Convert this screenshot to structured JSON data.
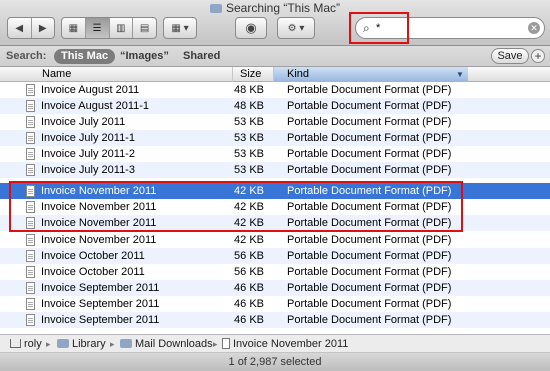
{
  "window": {
    "title": "Searching “This Mac”"
  },
  "toolbar": {
    "back_glyph": "◀",
    "forward_glyph": "▶",
    "view_icon_glyph": "▦",
    "view_list_glyph": "☰",
    "view_column_glyph": "▥",
    "view_coverflow_glyph": "▤",
    "arrange_glyph": "▦ ▾",
    "quicklook_glyph": "◉",
    "action_glyph": "⚙ ▾"
  },
  "search": {
    "value": "*",
    "clear_glyph": "✕"
  },
  "scope": {
    "label": "Search:",
    "this_mac": "This Mac",
    "images": "“Images”",
    "shared": "Shared",
    "save": "Save",
    "plus": "+"
  },
  "columns": {
    "name": "Name",
    "size": "Size",
    "kind": "Kind",
    "sort_arrow": "▼"
  },
  "files": [
    {
      "name": "Invoice August 2011",
      "size": "48 KB",
      "kind": "Portable Document Format (PDF)"
    },
    {
      "name": "Invoice August 2011-1",
      "size": "48 KB",
      "kind": "Portable Document Format (PDF)"
    },
    {
      "name": "Invoice July 2011",
      "size": "53 KB",
      "kind": "Portable Document Format (PDF)"
    },
    {
      "name": "Invoice July 2011-1",
      "size": "53 KB",
      "kind": "Portable Document Format (PDF)"
    },
    {
      "name": "Invoice July 2011-2",
      "size": "53 KB",
      "kind": "Portable Document Format (PDF)"
    },
    {
      "name": "Invoice July 2011-3",
      "size": "53 KB",
      "kind": "Portable Document Format (PDF)"
    },
    {
      "name": "Invoice November 2011",
      "size": "42 KB",
      "kind": "Portable Document Format (PDF)"
    },
    {
      "name": "Invoice November 2011",
      "size": "42 KB",
      "kind": "Portable Document Format (PDF)"
    },
    {
      "name": "Invoice November 2011",
      "size": "42 KB",
      "kind": "Portable Document Format (PDF)"
    },
    {
      "name": "Invoice November 2011",
      "size": "42 KB",
      "kind": "Portable Document Format (PDF)"
    },
    {
      "name": "Invoice October 2011",
      "size": "56 KB",
      "kind": "Portable Document Format (PDF)"
    },
    {
      "name": "Invoice October 2011",
      "size": "56 KB",
      "kind": "Portable Document Format (PDF)"
    },
    {
      "name": "Invoice September 2011",
      "size": "46 KB",
      "kind": "Portable Document Format (PDF)"
    },
    {
      "name": "Invoice September 2011",
      "size": "46 KB",
      "kind": "Portable Document Format (PDF)"
    },
    {
      "name": "Invoice September 2011",
      "size": "46 KB",
      "kind": "Portable Document Format (PDF)"
    }
  ],
  "path": {
    "home": "roly",
    "library": "Library",
    "mail_downloads": "Mail Downloads",
    "file": "Invoice November 2011",
    "chevron": "▸"
  },
  "status": {
    "text": "1 of 2,987 selected"
  },
  "colors": {
    "selection": "#3875d7",
    "alt_row": "#edf3fe",
    "annotation": "#e01010"
  }
}
